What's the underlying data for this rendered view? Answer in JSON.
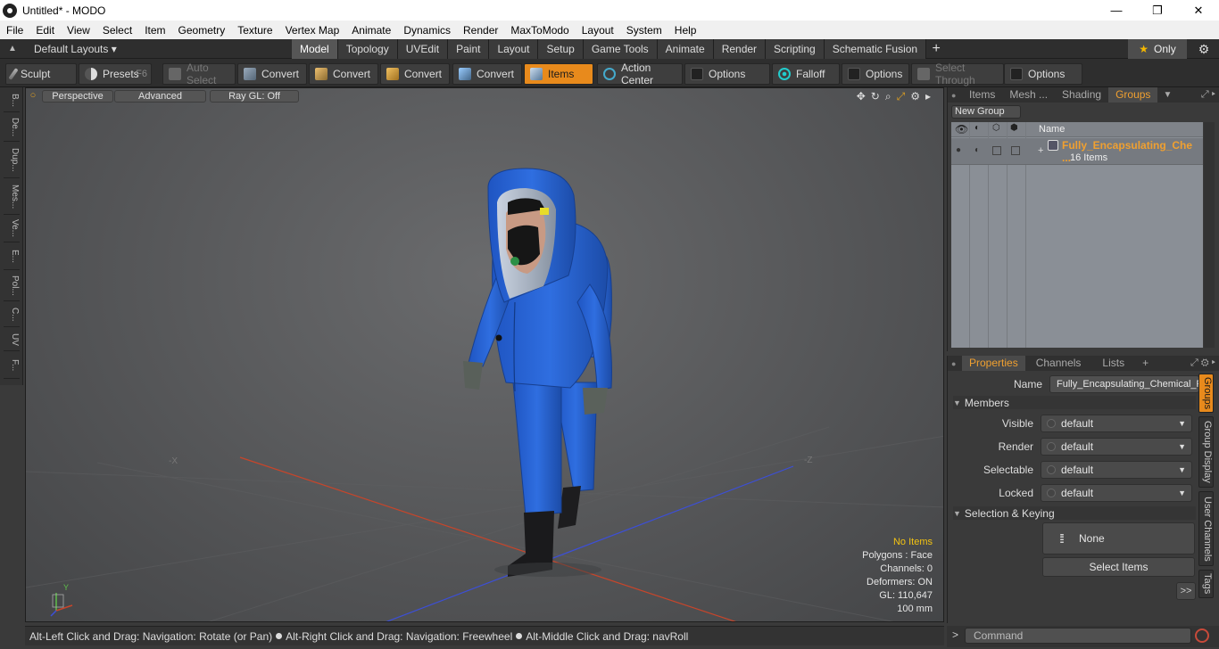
{
  "window": {
    "title": "Untitled* - MODO",
    "minimize": "—",
    "maximize": "❐",
    "close": "✕"
  },
  "menu": [
    "File",
    "Edit",
    "View",
    "Select",
    "Item",
    "Geometry",
    "Texture",
    "Vertex Map",
    "Animate",
    "Dynamics",
    "Render",
    "MaxToModo",
    "Layout",
    "System",
    "Help"
  ],
  "layoutbar": {
    "layout_select": "Default Layouts",
    "tabs": [
      "Model",
      "Topology",
      "UVEdit",
      "Paint",
      "Layout",
      "Setup",
      "Game Tools",
      "Animate",
      "Render",
      "Scripting",
      "Schematic Fusion"
    ],
    "active_tab": "Model",
    "plus": "+",
    "only_label": "Only"
  },
  "toolbar": {
    "sculpt": "Sculpt",
    "presets": "Presets",
    "presets_key": "F6",
    "auto_select": "Auto Select",
    "convert1": "Convert",
    "convert2": "Convert",
    "convert3": "Convert",
    "convert4": "Convert",
    "items": "Items",
    "action_center": "Action Center",
    "options1": "Options",
    "falloff": "Falloff",
    "options2": "Options",
    "select_through": "Select Through",
    "options3": "Options"
  },
  "left_tabs": [
    "B...",
    "De...",
    "Dup...",
    "Mes...",
    "Ve...",
    "E...",
    "Pol...",
    "C...",
    "UV",
    "F..."
  ],
  "viewport": {
    "perspective": "Perspective",
    "advanced": "Advanced",
    "raygl": "Ray GL: Off",
    "stats": {
      "no_items": "No Items",
      "polygons": "Polygons : Face",
      "channels": "Channels: 0",
      "deformers": "Deformers: ON",
      "gl": "GL: 110,647",
      "size": "100 mm"
    },
    "grid_label_x": "-X",
    "grid_label_z": "-Z",
    "axis_y": "Y"
  },
  "statusbar": {
    "hint1": "Alt-Left Click and Drag: Navigation: Rotate (or Pan)",
    "hint2": "Alt-Right Click and Drag: Navigation: Freewheel",
    "hint3": "Alt-Middle Click and Drag: navRoll"
  },
  "groups_panel": {
    "tabs": [
      "Items",
      "Mesh ...",
      "Shading",
      "Groups"
    ],
    "active_tab": "Groups",
    "new_group": "New Group",
    "name_header": "Name",
    "group_name": "Fully_Encapsulating_Che ...",
    "group_count": "16 Items"
  },
  "properties_panel": {
    "tabs": [
      "Properties",
      "Channels",
      "Lists"
    ],
    "active_tab": "Properties",
    "plus": "+",
    "name_label": "Name",
    "name_value": "Fully_Encapsulating_Chemical_Pr",
    "members_section": "Members",
    "visible_label": "Visible",
    "visible_value": "default",
    "render_label": "Render",
    "render_value": "default",
    "selectable_label": "Selectable",
    "selectable_value": "default",
    "locked_label": "Locked",
    "locked_value": "default",
    "keying_section": "Selection & Keying",
    "none_label": "None",
    "select_items": "Select Items",
    "more": ">>"
  },
  "right_vtabs": [
    "Groups",
    "Group Display",
    "User Channels",
    "Tags"
  ],
  "command": {
    "placeholder": "Command",
    "prompt": ">"
  },
  "colors": {
    "accent": "#e88a1c",
    "suit_blue": "#2f6ee0",
    "axis_red": "#c8452a",
    "axis_blue": "#3c4fd8"
  }
}
